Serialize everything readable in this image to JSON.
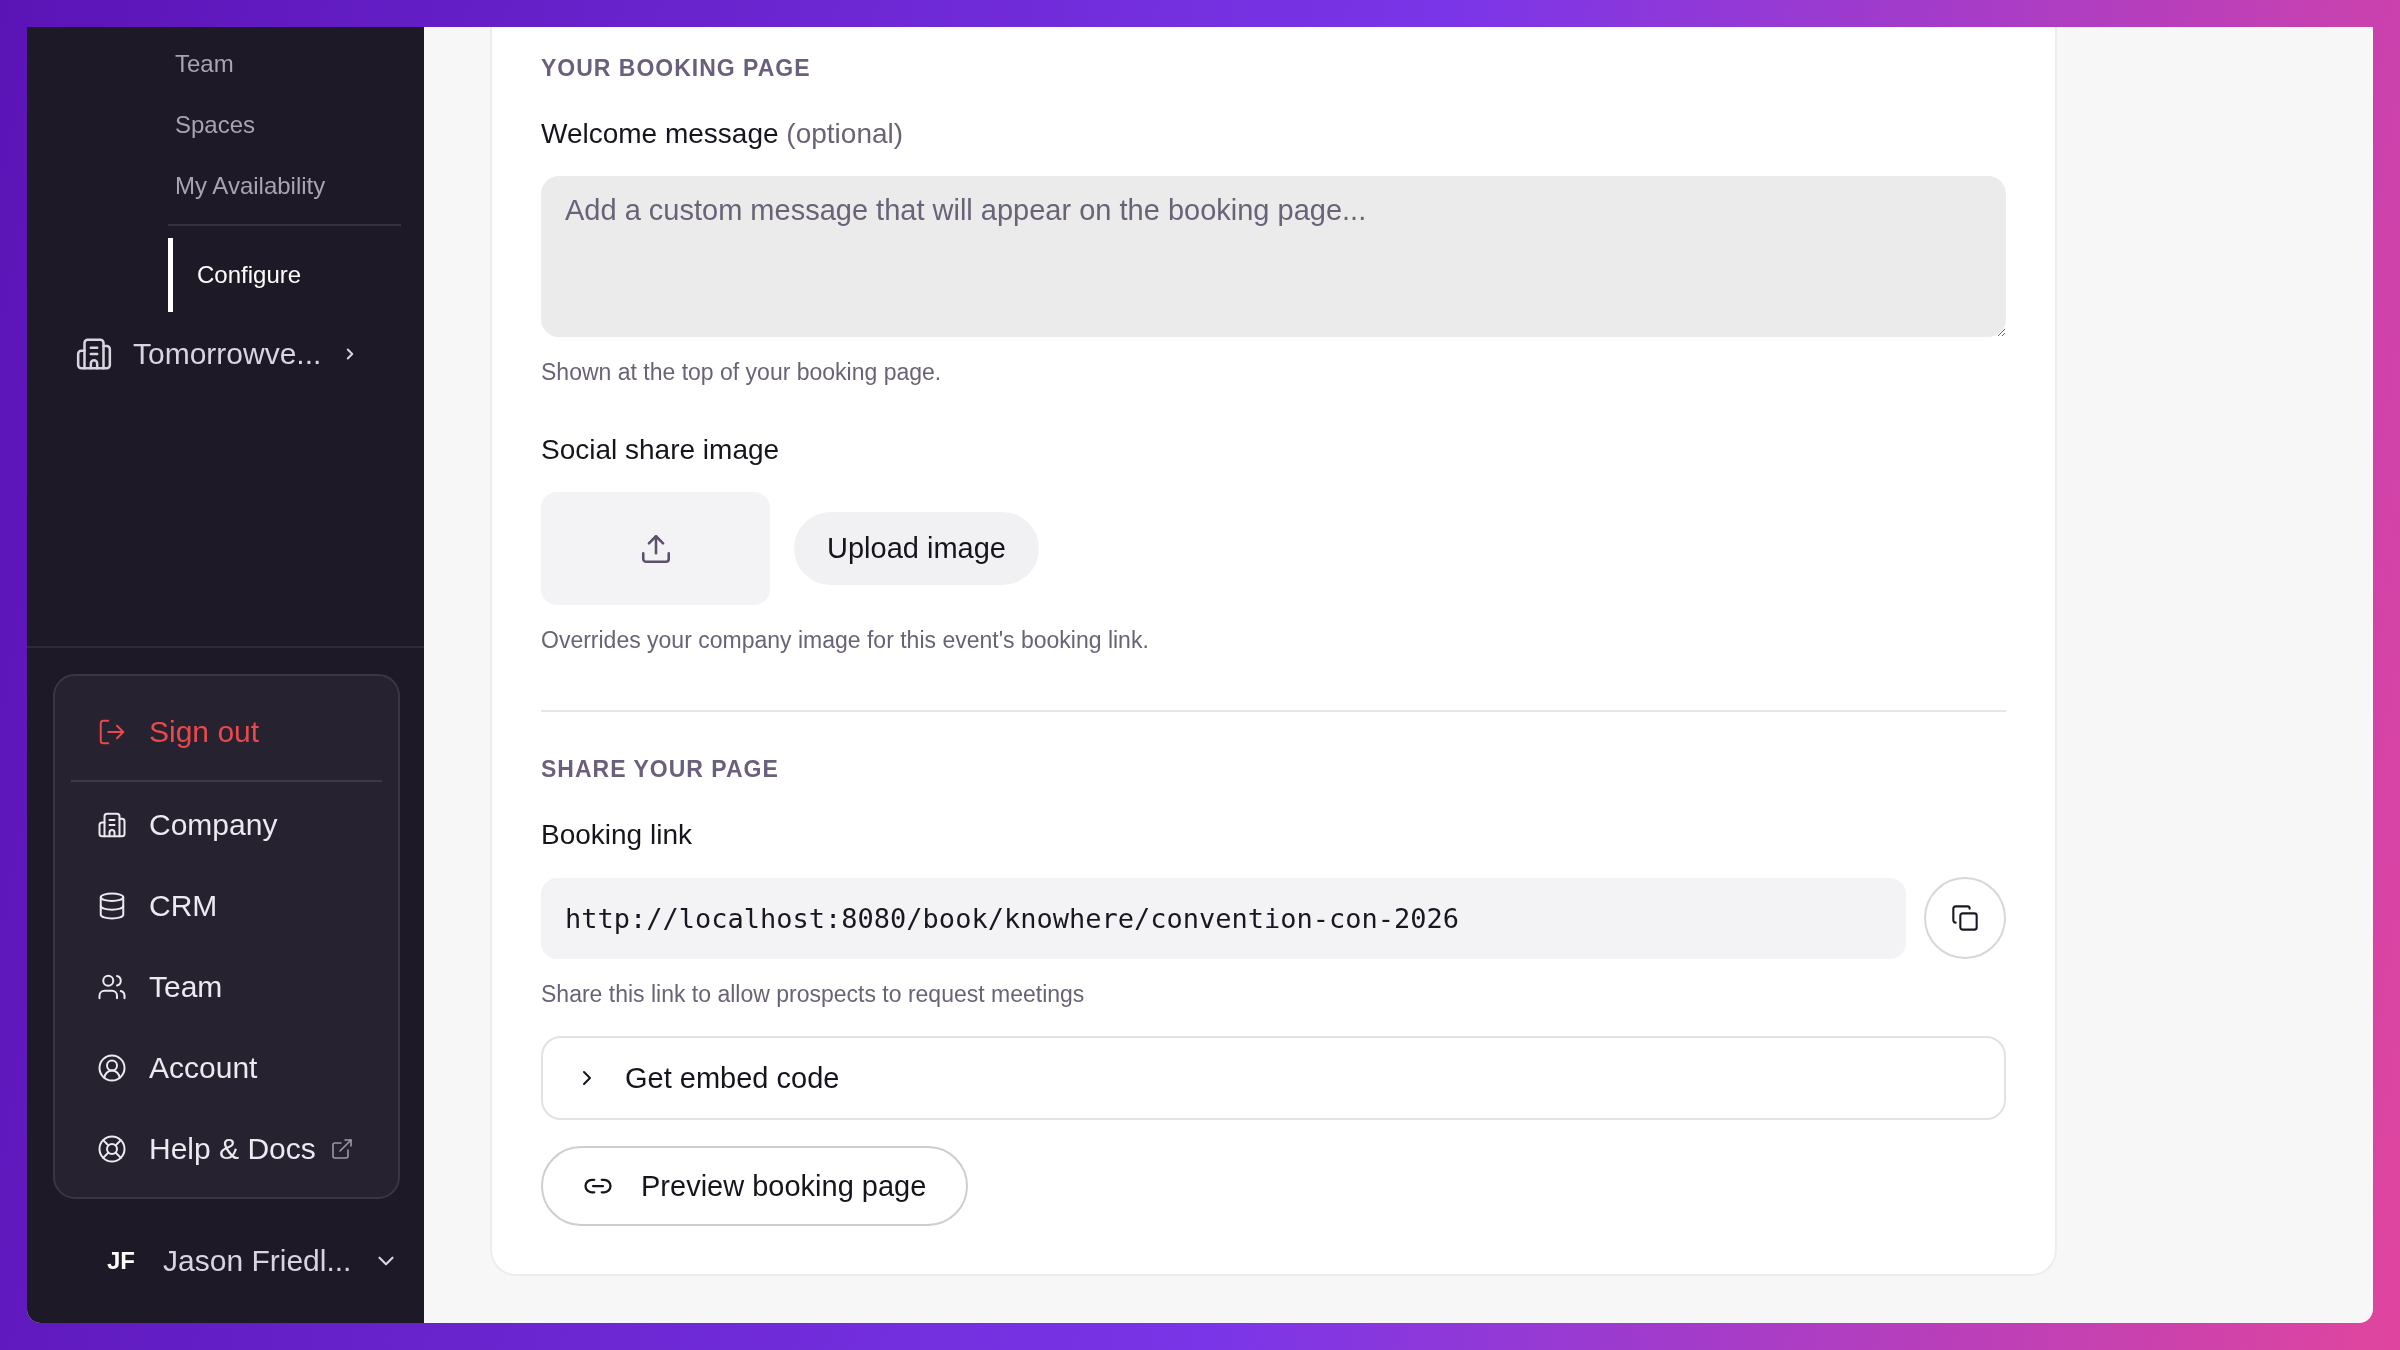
{
  "sidebar": {
    "sub_items": [
      {
        "label": "Team",
        "selected": false
      },
      {
        "label": "Spaces",
        "selected": false
      },
      {
        "label": "My Availability",
        "selected": false
      },
      {
        "label": "Configure",
        "selected": true
      }
    ],
    "workspace": {
      "label": "Tomorrowve..."
    },
    "menu": [
      {
        "label": "Sign out",
        "kind": "danger",
        "external": false
      },
      {
        "label": "Company",
        "kind": "normal",
        "external": false
      },
      {
        "label": "CRM",
        "kind": "normal",
        "external": false
      },
      {
        "label": "Team",
        "kind": "normal",
        "external": false
      },
      {
        "label": "Account",
        "kind": "normal",
        "external": false
      },
      {
        "label": "Help & Docs",
        "kind": "normal",
        "external": true
      }
    ],
    "user": {
      "initials": "JF",
      "name": "Jason Friedl..."
    }
  },
  "booking_page": {
    "heading": "YOUR BOOKING PAGE",
    "welcome": {
      "label": "Welcome message",
      "hint": "(optional)",
      "placeholder": "Add a custom message that will appear on the booking page...",
      "help": "Shown at the top of your booking page."
    },
    "social": {
      "label": "Social share image",
      "button": "Upload image",
      "help": "Overrides your company image for this event's booking link."
    }
  },
  "share": {
    "heading": "SHARE YOUR PAGE",
    "link_label": "Booking link",
    "link": "http://localhost:8080/book/knowhere/convention-con-2026",
    "help": "Share this link to allow prospects to request meetings",
    "embed": {
      "label": "Get embed code",
      "expanded": false
    },
    "preview": "Preview booking page"
  }
}
